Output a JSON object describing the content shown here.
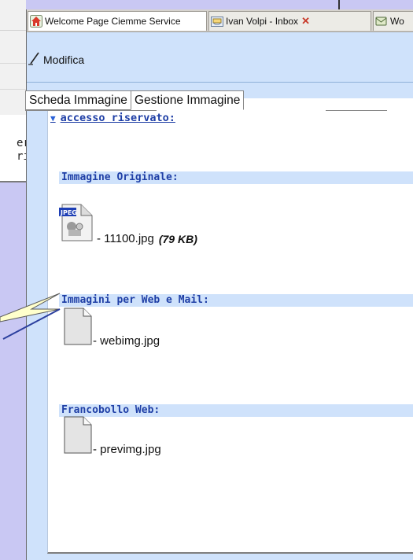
{
  "background": {
    "code_lines": [
      "er",
      "ri"
    ]
  },
  "browser": {
    "tabs": [
      {
        "label": "Welcome Page Ciemme Service",
        "icon": "home-icon"
      },
      {
        "label": "Ivan Volpi - Inbox",
        "icon": "inbox-icon",
        "close": "✕"
      },
      {
        "label": "Wo",
        "icon": "mail-icon"
      }
    ]
  },
  "toolbar": {
    "edit_label": "Modifica",
    "edit_icon": "pencil-icon"
  },
  "panel": {
    "tabs": [
      {
        "label": "Scheda Immagine"
      },
      {
        "label": "Gestione Immagine"
      }
    ],
    "access_toggle": "accesso riservato:",
    "sections": [
      {
        "title": "Immagine Originale:",
        "file": {
          "name": "- 11100.jpg",
          "size": "(79 KB)",
          "icon": "jpeg-file-icon",
          "badge": "JPEG"
        }
      },
      {
        "title": "Immagini per Web e Mail:",
        "file": {
          "name": "- webimg.jpg",
          "icon": "blank-file-icon"
        }
      },
      {
        "title": "Francobollo Web:",
        "file": {
          "name": "- previmg.jpg",
          "icon": "blank-file-icon"
        }
      }
    ]
  },
  "colors": {
    "page_bg": "#c9c8f3",
    "header_blue": "#cfe2fb",
    "link_blue": "#1f3fa6",
    "callout_yellow": "#ffffcc"
  }
}
